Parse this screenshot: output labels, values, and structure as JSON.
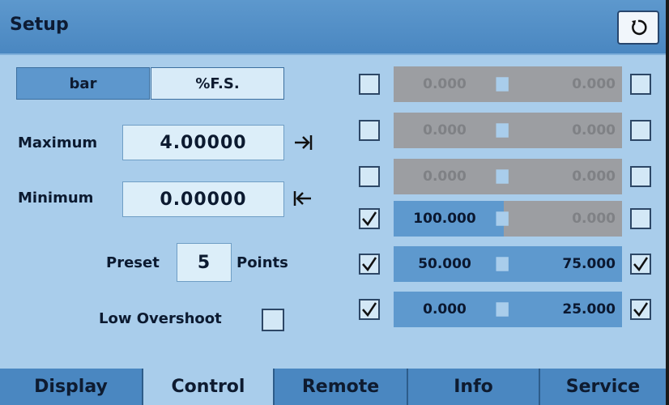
{
  "header": {
    "title": "Setup",
    "refresh_icon": "refresh-icon"
  },
  "units": {
    "bar": "bar",
    "percent_fs": "%F.S."
  },
  "range": {
    "maximum_label": "Maximum",
    "maximum_value": "4.00000",
    "minimum_label": "Minimum",
    "minimum_value": "0.00000"
  },
  "preset": {
    "label": "Preset",
    "value": "5",
    "unit": "Points"
  },
  "low_overshoot": {
    "label": "Low Overshoot",
    "checked": false
  },
  "points": [
    {
      "left_checked": false,
      "left_value": "0.000",
      "left_enabled": false,
      "right_value": "0.000",
      "right_enabled": false,
      "right_checked": false
    },
    {
      "left_checked": false,
      "left_value": "0.000",
      "left_enabled": false,
      "right_value": "0.000",
      "right_enabled": false,
      "right_checked": false
    },
    {
      "left_checked": false,
      "left_value": "0.000",
      "left_enabled": false,
      "right_value": "0.000",
      "right_enabled": false,
      "right_checked": false
    },
    {
      "left_checked": true,
      "left_value": "100.000",
      "left_enabled": true,
      "right_value": "0.000",
      "right_enabled": false,
      "right_checked": false
    },
    {
      "left_checked": true,
      "left_value": "50.000",
      "left_enabled": true,
      "right_value": "75.000",
      "right_enabled": true,
      "right_checked": true
    },
    {
      "left_checked": true,
      "left_value": "0.000",
      "left_enabled": true,
      "right_value": "25.000",
      "right_enabled": true,
      "right_checked": true
    }
  ],
  "tabs": [
    {
      "label": "Display",
      "active": false
    },
    {
      "label": "Control",
      "active": true
    },
    {
      "label": "Remote",
      "active": false
    },
    {
      "label": "Info",
      "active": false
    },
    {
      "label": "Service",
      "active": false
    }
  ],
  "colors": {
    "background": "#a9cdeb",
    "header": "#4a87c1",
    "active_cell": "#5e99ce",
    "disabled_cell": "#9c9ea2"
  }
}
